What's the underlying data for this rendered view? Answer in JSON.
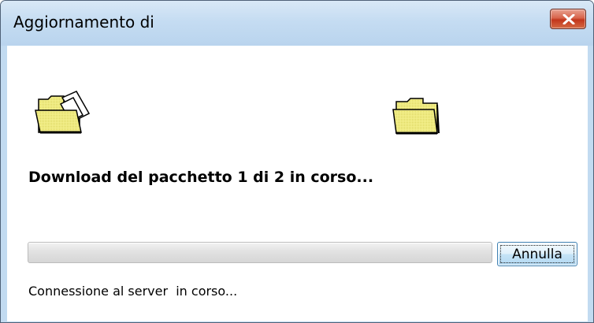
{
  "window": {
    "title": "Aggiornamento di"
  },
  "titlebar": {
    "close_icon": "close-x-icon"
  },
  "transfer": {
    "source_icon": "folder-with-documents-icon",
    "destination_icon": "folder-icon",
    "heading": "Download del pacchetto 1 di 2 in corso..."
  },
  "progress": {
    "percent": 0
  },
  "actions": {
    "cancel_label": "Annulla"
  },
  "status": {
    "message": "Connessione al server  in corso..."
  },
  "colors": {
    "titlebar": "#c5dcf2",
    "frame": "#c2dbf1",
    "close_button": "#c2361c",
    "folder_yellow": "#f2ee8a",
    "button_border": "#3c7fb1",
    "progress_track": "#e3e3e3"
  }
}
